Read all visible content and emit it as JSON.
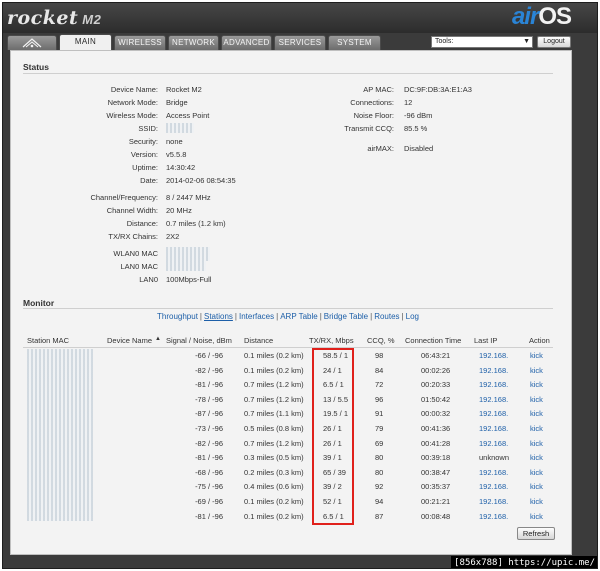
{
  "header": {
    "brand": "rocket",
    "model": "M2",
    "os_air": "air",
    "os_name": "OS"
  },
  "tabs": [
    {
      "label": "MAIN",
      "active": true
    },
    {
      "label": "WIRELESS"
    },
    {
      "label": "NETWORK"
    },
    {
      "label": "ADVANCED"
    },
    {
      "label": "SERVICES"
    },
    {
      "label": "SYSTEM"
    }
  ],
  "tools": {
    "label": "Tools:",
    "arrow": "▼"
  },
  "logout_label": "Logout",
  "status": {
    "title": "Status",
    "left": [
      {
        "label": "Device Name:",
        "value": "Rocket M2"
      },
      {
        "label": "Network Mode:",
        "value": "Bridge"
      },
      {
        "label": "Wireless Mode:",
        "value": "Access Point"
      },
      {
        "label": "SSID:",
        "value": ""
      },
      {
        "label": "Security:",
        "value": "none"
      },
      {
        "label": "Version:",
        "value": "v5.5.8"
      },
      {
        "label": "Uptime:",
        "value": "14:30:42"
      },
      {
        "label": "Date:",
        "value": "2014-02-06 08:54:35"
      },
      {
        "label": "Channel/Frequency:",
        "value": "8 / 2447 MHz"
      },
      {
        "label": "Channel Width:",
        "value": "20 MHz"
      },
      {
        "label": "Distance:",
        "value": "0.7 miles (1.2 km)"
      },
      {
        "label": "TX/RX Chains:",
        "value": "2X2"
      },
      {
        "label": "WLAN0 MAC",
        "value": ""
      },
      {
        "label": "LAN0 MAC",
        "value": ""
      },
      {
        "label": "LAN0",
        "value": "100Mbps-Full"
      }
    ],
    "right": [
      {
        "label": "AP MAC:",
        "value": "DC:9F:DB:3A:E1:A3"
      },
      {
        "label": "Connections:",
        "value": "12"
      },
      {
        "label": "Noise Floor:",
        "value": "-96 dBm"
      },
      {
        "label": "Transmit CCQ:",
        "value": "85.5 %"
      },
      {
        "label": "airMAX:",
        "value": "Disabled"
      }
    ]
  },
  "monitor": {
    "title": "Monitor",
    "links": [
      "Throughput",
      "Stations",
      "Interfaces",
      "ARP Table",
      "Bridge Table",
      "Routes",
      "Log"
    ],
    "current_link": "Stations",
    "columns": [
      "Station MAC",
      "Device Name",
      "▲",
      "Signal / Noise, dBm",
      "Distance",
      "TX/RX, Mbps",
      "CCQ, %",
      "Connection Time",
      "Last IP",
      "Action"
    ],
    "rows": [
      {
        "signal": "-66 / -96",
        "distance": "0.1 miles (0.2 km)",
        "txrx": "58.5 / 1",
        "ccq": "98",
        "time": "06:43:21",
        "ip": "192.168.",
        "action": "kick"
      },
      {
        "signal": "-82 / -96",
        "distance": "0.1 miles (0.2 km)",
        "txrx": "24 / 1",
        "ccq": "84",
        "time": "00:02:26",
        "ip": "192.168.",
        "action": "kick"
      },
      {
        "signal": "-81 / -96",
        "distance": "0.7 miles (1.2 km)",
        "txrx": "6.5 / 1",
        "ccq": "72",
        "time": "00:20:33",
        "ip": "192.168.",
        "action": "kick"
      },
      {
        "signal": "-78 / -96",
        "distance": "0.7 miles (1.2 km)",
        "txrx": "13 / 5.5",
        "ccq": "96",
        "time": "01:50:42",
        "ip": "192.168.",
        "action": "kick"
      },
      {
        "signal": "-87 / -96",
        "distance": "0.7 miles (1.1 km)",
        "txrx": "19.5 / 1",
        "ccq": "91",
        "time": "00:00:32",
        "ip": "192.168.",
        "action": "kick"
      },
      {
        "signal": "-73 / -96",
        "distance": "0.5 miles (0.8 km)",
        "txrx": "26 / 1",
        "ccq": "79",
        "time": "00:41:36",
        "ip": "192.168.",
        "action": "kick"
      },
      {
        "signal": "-82 / -96",
        "distance": "0.7 miles (1.2 km)",
        "txrx": "26 / 1",
        "ccq": "69",
        "time": "00:41:28",
        "ip": "192.168.",
        "action": "kick"
      },
      {
        "signal": "-81 / -96",
        "distance": "0.3 miles (0.5 km)",
        "txrx": "39 / 1",
        "ccq": "80",
        "time": "00:39:18",
        "ip": "unknown",
        "action": "kick"
      },
      {
        "signal": "-68 / -96",
        "distance": "0.2 miles (0.3 km)",
        "txrx": "65 / 39",
        "ccq": "80",
        "time": "00:38:47",
        "ip": "192.168.",
        "action": "kick"
      },
      {
        "signal": "-75 / -96",
        "distance": "0.4 miles (0.6 km)",
        "txrx": "39 / 2",
        "ccq": "92",
        "time": "00:35:37",
        "ip": "192.168.",
        "action": "kick"
      },
      {
        "signal": "-69 / -96",
        "distance": "0.1 miles (0.2 km)",
        "txrx": "52 / 1",
        "ccq": "94",
        "time": "00:21:21",
        "ip": "192.168.",
        "action": "kick"
      },
      {
        "signal": "-81 / -96",
        "distance": "0.1 miles (0.2 km)",
        "txrx": "6.5 / 1",
        "ccq": "87",
        "time": "00:08:48",
        "ip": "192.168.",
        "action": "kick"
      }
    ],
    "refresh_label": "Refresh"
  },
  "watermark": "[856x788] https://upic.me/",
  "colors": {
    "accent": "#1d5fa8",
    "highlight": "#e0201b",
    "header": "#3b3b3b"
  }
}
